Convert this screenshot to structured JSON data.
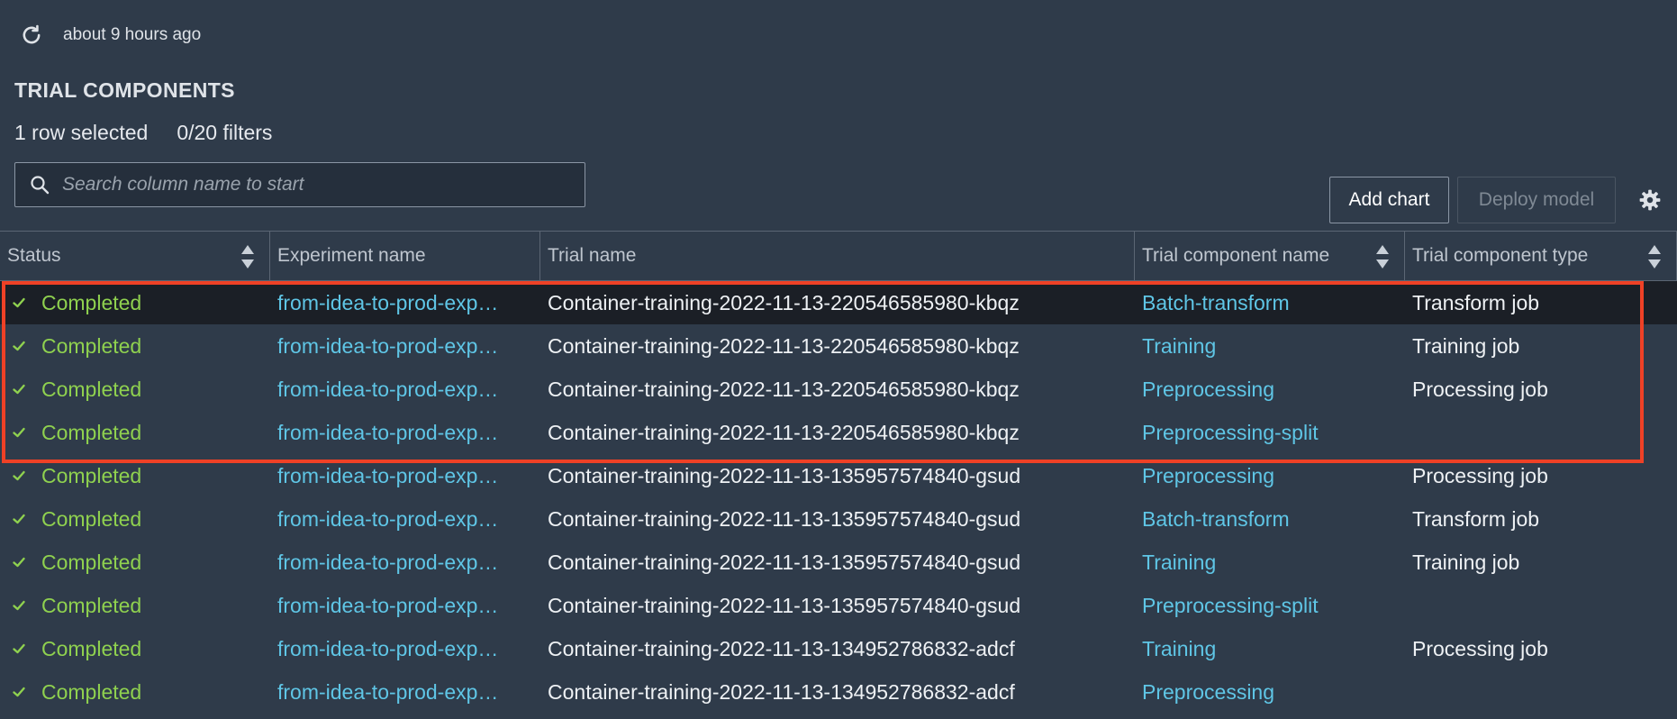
{
  "toolbar": {
    "last_refreshed": "about 9 hours ago",
    "refresh_icon": "refresh-icon"
  },
  "section": {
    "title": "TRIAL COMPONENTS",
    "rows_selected": "1 row selected",
    "filters": "0/20 filters"
  },
  "search": {
    "placeholder": "Search column name to start",
    "value": ""
  },
  "actions": {
    "add_chart": "Add chart",
    "deploy_model": "Deploy model",
    "settings_icon": "gear-icon"
  },
  "columns": [
    {
      "label": "Status",
      "sortable": true
    },
    {
      "label": "Experiment name",
      "sortable": false
    },
    {
      "label": "Trial name",
      "sortable": false
    },
    {
      "label": "Trial component name",
      "sortable": true
    },
    {
      "label": "Trial component type",
      "sortable": true
    }
  ],
  "rows": [
    {
      "status": "Completed",
      "experiment": "from-idea-to-prod-exp…",
      "trial": "Container-training-2022-11-13-220546585980-kbqz",
      "component": "Batch-transform",
      "type": "Transform job",
      "selected": true
    },
    {
      "status": "Completed",
      "experiment": "from-idea-to-prod-exp…",
      "trial": "Container-training-2022-11-13-220546585980-kbqz",
      "component": "Training",
      "type": "Training job",
      "selected": false
    },
    {
      "status": "Completed",
      "experiment": "from-idea-to-prod-exp…",
      "trial": "Container-training-2022-11-13-220546585980-kbqz",
      "component": "Preprocessing",
      "type": "Processing job",
      "selected": false
    },
    {
      "status": "Completed",
      "experiment": "from-idea-to-prod-exp…",
      "trial": "Container-training-2022-11-13-220546585980-kbqz",
      "component": "Preprocessing-split",
      "type": "",
      "selected": false
    },
    {
      "status": "Completed",
      "experiment": "from-idea-to-prod-exp…",
      "trial": "Container-training-2022-11-13-135957574840-gsud",
      "component": "Preprocessing",
      "type": "Processing job",
      "selected": false
    },
    {
      "status": "Completed",
      "experiment": "from-idea-to-prod-exp…",
      "trial": "Container-training-2022-11-13-135957574840-gsud",
      "component": "Batch-transform",
      "type": "Transform job",
      "selected": false
    },
    {
      "status": "Completed",
      "experiment": "from-idea-to-prod-exp…",
      "trial": "Container-training-2022-11-13-135957574840-gsud",
      "component": "Training",
      "type": "Training job",
      "selected": false
    },
    {
      "status": "Completed",
      "experiment": "from-idea-to-prod-exp…",
      "trial": "Container-training-2022-11-13-135957574840-gsud",
      "component": "Preprocessing-split",
      "type": "",
      "selected": false
    },
    {
      "status": "Completed",
      "experiment": "from-idea-to-prod-exp…",
      "trial": "Container-training-2022-11-13-134952786832-adcf",
      "component": "Training",
      "type": "Processing job",
      "selected": false
    },
    {
      "status": "Completed",
      "experiment": "from-idea-to-prod-exp…",
      "trial": "Container-training-2022-11-13-134952786832-adcf",
      "component": "Preprocessing",
      "type": "",
      "selected": false
    }
  ],
  "colors": {
    "background": "#2f3b4a",
    "selected_row": "#1b1f26",
    "status_green": "#8fd14f",
    "link_blue": "#5fc6e6",
    "highlight_red": "#ef4126"
  }
}
